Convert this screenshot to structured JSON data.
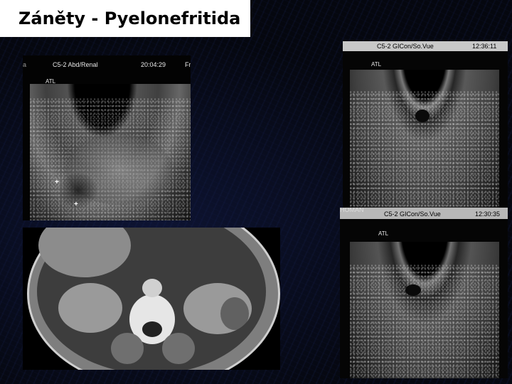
{
  "title": "Záněty - Pyelonefritida",
  "us1": {
    "probe": "C5-2 Abd/Renal",
    "time": "20:04:29",
    "tag": "Fr",
    "brand": "ATL",
    "mark": "a",
    "plus": "+"
  },
  "us2": {
    "probe": "C5-2 GICon/So.Vue",
    "time": "12:36:11",
    "brand": "ATL"
  },
  "us3": {
    "probe": "C5-2 GICon/So.Vue",
    "time": "12:30:35",
    "brand": "ATL",
    "left_tag": "HOMAN"
  }
}
